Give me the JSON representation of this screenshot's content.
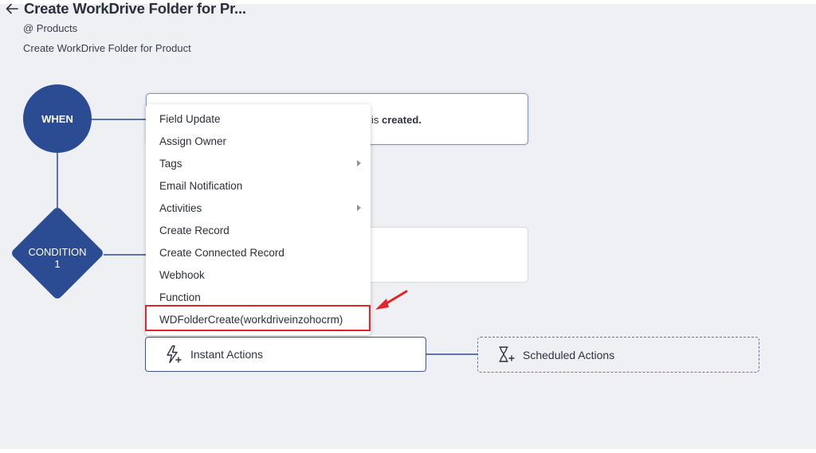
{
  "header": {
    "title": "Create WorkDrive Folder for Pr...",
    "module": "@ Products",
    "description": "Create WorkDrive Folder for Product"
  },
  "workflow": {
    "when_label": "WHEN",
    "when_text_suffix": "is",
    "when_text_bold": "created.",
    "condition_label_line1": "CONDITION",
    "condition_label_line2": "1"
  },
  "actions": {
    "instant_label": "Instant Actions",
    "scheduled_label": "Scheduled Actions"
  },
  "menu": {
    "items": [
      {
        "label": "Field Update",
        "has_submenu": false
      },
      {
        "label": "Assign Owner",
        "has_submenu": false
      },
      {
        "label": "Tags",
        "has_submenu": true
      },
      {
        "label": "Email Notification",
        "has_submenu": false
      },
      {
        "label": "Activities",
        "has_submenu": true
      },
      {
        "label": "Create Record",
        "has_submenu": false
      },
      {
        "label": "Create Connected Record",
        "has_submenu": false
      },
      {
        "label": "Webhook",
        "has_submenu": false
      },
      {
        "label": "Function",
        "has_submenu": false
      }
    ],
    "highlighted_item": "WDFolderCreate(workdriveinzohocrm)"
  },
  "colors": {
    "node_fill": "#2b4b93",
    "highlight_red": "#e0262a",
    "canvas_bg": "#eef0f3"
  }
}
